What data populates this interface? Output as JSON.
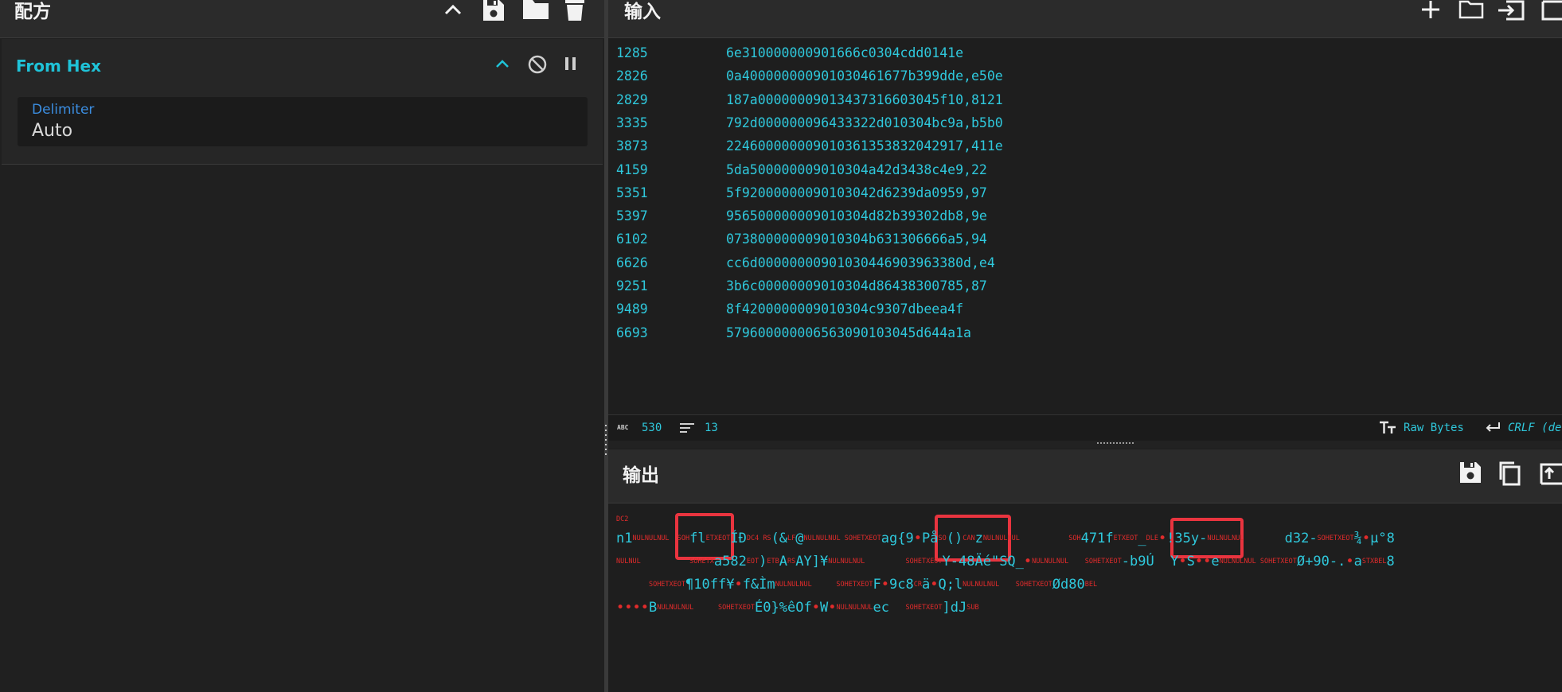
{
  "recipe": {
    "title": "配方",
    "operation": {
      "name": "From Hex",
      "delimiter_label": "Delimiter",
      "delimiter_value": "Auto"
    }
  },
  "input": {
    "title": "输入",
    "lines": [
      {
        "id": "1285",
        "hex": "6e310000000901666c0304cdd0141e"
      },
      {
        "id": "2826",
        "hex": "0a40000000090103046167 7b399dde,e50e"
      },
      {
        "id": "2829",
        "hex": "187a000000090134373166 03045f10,8121"
      },
      {
        "id": "3335",
        "hex": "792d000000096433322d010304bc9a,b5b0"
      },
      {
        "id": "3873",
        "hex": "2246000000090103613538 32042917,411e"
      },
      {
        "id": "4159",
        "hex": "5da50000000901030 4a42d3438c4e9,22"
      },
      {
        "id": "5351",
        "hex": "5f92000000090103042d6239da0959,97"
      },
      {
        "id": "5397",
        "hex": "956500000009010304d82b39302db8,9e"
      },
      {
        "id": "6102",
        "hex": "073800000009010304b631306666a5,94"
      },
      {
        "id": "6626",
        "hex": "cc6d00000000901030446903963380d,e4"
      },
      {
        "id": "9251",
        "hex": "3b6c00000009010304d86438300785,87"
      },
      {
        "id": "9489",
        "hex": "8f4200000009010304c9307dbeea4f"
      },
      {
        "id": "6693",
        "hex": "579600000006563090103045d644a1a"
      }
    ],
    "status": {
      "chars_icon_text": "ABC",
      "chars": "530",
      "lines": "13",
      "encoding": "Raw Bytes",
      "eol": "CRLF (de"
    }
  },
  "output": {
    "title": "输出",
    "lines": [
      [
        [
          "c",
          "DC2"
        ]
      ],
      [
        [
          "t",
          "n1"
        ],
        [
          "c",
          "NULNULNUL"
        ],
        [
          "t",
          " "
        ],
        [
          "c",
          "SOH"
        ],
        [
          "t",
          "fl"
        ],
        [
          "c",
          "ETXEOT"
        ],
        [
          "t",
          "ÍÐ"
        ],
        [
          "c",
          "DC4 RS"
        ],
        [
          "t",
          "(&"
        ],
        [
          "c",
          "LF"
        ],
        [
          "t",
          "@"
        ],
        [
          "c",
          "NULNULNUL SOHETXEOT"
        ],
        [
          "t",
          "ag{9"
        ],
        [
          "d",
          "•"
        ],
        [
          "t",
          "På"
        ],
        [
          "c",
          "SO"
        ],
        [
          "t",
          "()"
        ],
        [
          "c",
          "CAN"
        ],
        [
          "t",
          "z"
        ],
        [
          "c",
          "NULNULNUL"
        ],
        [
          "t",
          "      "
        ],
        [
          "c",
          "SOH"
        ],
        [
          "t",
          "471f"
        ],
        [
          "c",
          "ETXEOT"
        ],
        [
          "t",
          "_"
        ],
        [
          "c",
          "DLE"
        ],
        [
          "d",
          "•"
        ],
        [
          "t",
          "!35y-"
        ],
        [
          "c",
          "NULNULNUL"
        ],
        [
          "t",
          "     d32-"
        ],
        [
          "c",
          "SOHETXEOT"
        ],
        [
          "t",
          "¾"
        ],
        [
          "d",
          "•"
        ],
        [
          "t",
          "µ°8"
        ]
      ],
      [
        [
          "c",
          "NULNUL"
        ],
        [
          "t",
          "      "
        ],
        [
          "c",
          "SOHETX"
        ],
        [
          "t",
          "a582"
        ],
        [
          "c",
          "EOT"
        ],
        [
          "t",
          ")"
        ],
        [
          "c",
          "ETB"
        ],
        [
          "t",
          "A"
        ],
        [
          "c",
          "RS"
        ],
        [
          "t",
          "AY]¥"
        ],
        [
          "c",
          "NULNULNUL"
        ],
        [
          "t",
          "     "
        ],
        [
          "c",
          "SOHETXEOT"
        ],
        [
          "t",
          "Y-48Äé\"SQ_"
        ],
        [
          "d",
          "•"
        ],
        [
          "c",
          "NULNULNUL"
        ],
        [
          "t",
          "  "
        ],
        [
          "c",
          "SOHETXEOT"
        ],
        [
          "t",
          "-b9Ú  Y"
        ],
        [
          "d",
          "•"
        ],
        [
          "t",
          "S"
        ],
        [
          "d",
          "••"
        ],
        [
          "t",
          "e"
        ],
        [
          "c",
          "NULNULNUL SOHETXEOT"
        ],
        [
          "t",
          "Ø+90-."
        ],
        [
          "d",
          "•"
        ],
        [
          "t",
          "a"
        ],
        [
          "c",
          "STXBEL"
        ],
        [
          "t",
          "8"
        ]
      ],
      [
        [
          "t",
          "    "
        ],
        [
          "c",
          "SOHETXEOT"
        ],
        [
          "t",
          "¶10ff¥"
        ],
        [
          "d",
          "•"
        ],
        [
          "t",
          "f&Ìm"
        ],
        [
          "c",
          "NULNULNUL"
        ],
        [
          "t",
          "   "
        ],
        [
          "c",
          "SOHETXEOT"
        ],
        [
          "t",
          "F"
        ],
        [
          "d",
          "•"
        ],
        [
          "t",
          "9c8"
        ],
        [
          "c",
          "CR"
        ],
        [
          "t",
          "ä"
        ],
        [
          "d",
          "•"
        ],
        [
          "t",
          "Q;l"
        ],
        [
          "c",
          "NULNULNUL"
        ],
        [
          "t",
          "  "
        ],
        [
          "c",
          "SOHETXEOT"
        ],
        [
          "t",
          "Ød80"
        ],
        [
          "c",
          "BEL"
        ]
      ],
      [
        [
          "d",
          "••••"
        ],
        [
          "t",
          "B"
        ],
        [
          "c",
          "NULNULNUL"
        ],
        [
          "t",
          "   "
        ],
        [
          "c",
          "SOHETXEOT"
        ],
        [
          "t",
          "É0}%êOf"
        ],
        [
          "d",
          "•"
        ],
        [
          "t",
          "W"
        ],
        [
          "d",
          "•"
        ],
        [
          "c",
          "NULNULNUL"
        ],
        [
          "t",
          "ec  "
        ],
        [
          "c",
          "SOHETXEOT"
        ],
        [
          "t",
          "]dJ"
        ],
        [
          "c",
          "SUB"
        ]
      ]
    ]
  },
  "icons": {
    "recipe_collapse": "chevron-up-icon",
    "recipe_save": "save-icon",
    "recipe_load": "folder-icon",
    "recipe_clear": "trash-icon",
    "op_collapse": "chevron-up-icon",
    "op_disable": "disable-icon",
    "op_pause": "pause-icon",
    "input_add": "plus-icon",
    "input_open_folder": "folder-icon",
    "input_open_file": "import-icon",
    "output_save": "save-icon",
    "output_copy": "copy-icon",
    "output_replace_input": "export-icon"
  },
  "colors": {
    "accent": "#1fc3d8",
    "control_char": "#e02b2b",
    "highlight_box": "#e9343f",
    "field_label": "#3b8de0"
  }
}
